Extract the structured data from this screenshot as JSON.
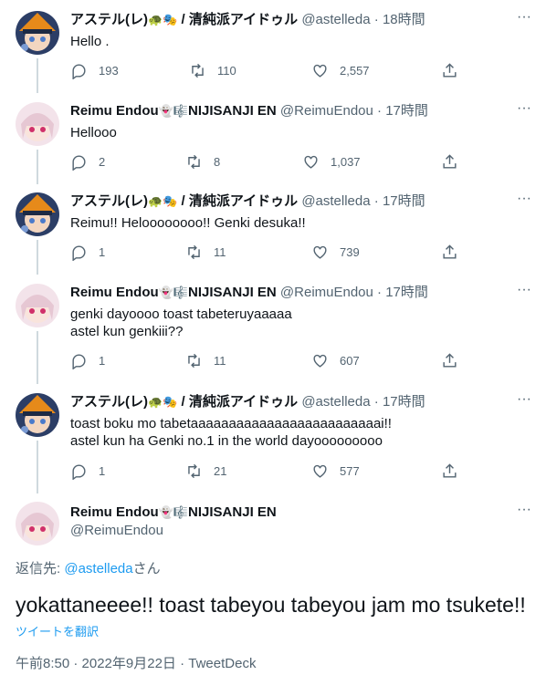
{
  "tweets": [
    {
      "user": "astel",
      "name": "アステル(レ)",
      "emoji": "🐢🎭",
      "name_suffix": " / 清純派アイドゥル",
      "handle": "@astelleda",
      "time": "18時間",
      "text": "Hello .",
      "reply": "193",
      "retweet": "110",
      "like": "2,557"
    },
    {
      "user": "reimu",
      "name": "Reimu Endou",
      "emoji": "👻🎼",
      "name_suffix": "NIJISANJI EN",
      "handle": "@ReimuEndou",
      "time": "17時間",
      "text": "Hellooo",
      "reply": "2",
      "retweet": "8",
      "like": "1,037"
    },
    {
      "user": "astel",
      "name": "アステル(レ)",
      "emoji": "🐢🎭",
      "name_suffix": " / 清純派アイドゥル",
      "handle": "@astelleda",
      "time": "17時間",
      "text": "Reimu!! Heloooooooo!! Genki desuka!!",
      "reply": "1",
      "retweet": "11",
      "like": "739"
    },
    {
      "user": "reimu",
      "name": "Reimu Endou",
      "emoji": "👻🎼",
      "name_suffix": "NIJISANJI EN",
      "handle": "@ReimuEndou",
      "time": "17時間",
      "text": "genki dayoooo toast tabeteruyaaaaa\nastel kun genkiii??",
      "reply": "1",
      "retweet": "11",
      "like": "607"
    },
    {
      "user": "astel",
      "name": "アステル(レ)",
      "emoji": "🐢🎭",
      "name_suffix": " / 清純派アイドゥル",
      "handle": "@astelleda",
      "time": "17時間",
      "text": "toast boku mo tabetaaaaaaaaaaaaaaaaaaaaaaaaai!!\nastel kun ha Genki no.1 in the world dayooooooooo",
      "reply": "1",
      "retweet": "21",
      "like": "577"
    }
  ],
  "focus": {
    "name": "Reimu Endou",
    "emoji": "👻🎼",
    "name_suffix": "NIJISANJI EN",
    "handle": "@ReimuEndou",
    "reply_prefix": "返信先: ",
    "reply_link": "@astelleda",
    "reply_suffix": "さん",
    "text": "yokattaneeee!! toast tabeyou tabeyou jam mo tsukete!!",
    "translate": "ツイートを翻訳",
    "meta": "午前8:50 · 2022年9月22日 · TweetDeck"
  },
  "icons": {
    "reply": "reply-icon",
    "retweet": "retweet-icon",
    "like": "like-icon",
    "share": "share-icon",
    "more": "more-icon"
  },
  "colors": {
    "link": "#1d9bf0",
    "muted": "#536471",
    "thread_line": "#cfd9de"
  }
}
